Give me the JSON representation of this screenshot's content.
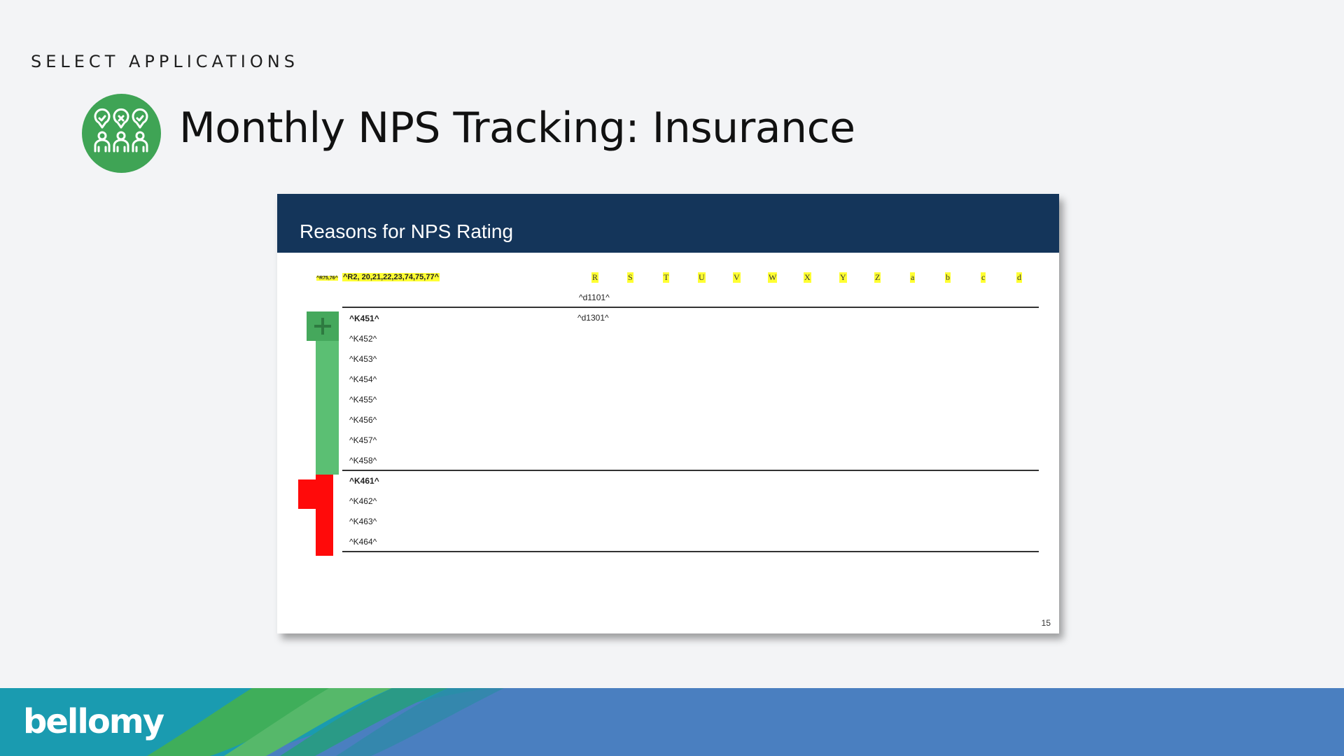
{
  "header": {
    "eyebrow": "SELECT APPLICATIONS",
    "title": "Monthly NPS Tracking: Insurance",
    "icon": "voting-people-icon"
  },
  "slide": {
    "title": "Reasons for NPS Rating",
    "code_small": "^R75,76^",
    "code_main": "^R2, 20,21,22,23,74,75,77^",
    "column_letters": [
      "R",
      "S",
      "T",
      "U",
      "V",
      "W",
      "X",
      "Y",
      "Z",
      "a",
      "b",
      "c",
      "d"
    ],
    "ref_top": "^d1101^",
    "ref_row": "^d1301^",
    "positive_rows": [
      "^K451^",
      "^K452^",
      "^K453^",
      "^K454^",
      "^K455^",
      "^K456^",
      "^K457^",
      "^K458^"
    ],
    "negative_rows": [
      "^K461^",
      "^K462^",
      "^K463^",
      "^K464^"
    ],
    "page_number": "15",
    "colors": {
      "header_bg": "#14355a",
      "highlight": "#ffff33",
      "positive": "#5bbf73",
      "negative": "#ff0a0a"
    }
  },
  "footer": {
    "brand": "bellomy",
    "colors": {
      "band": "#4a7fc0",
      "teal": "#1a9bb0",
      "green": "#3fae5a"
    }
  }
}
